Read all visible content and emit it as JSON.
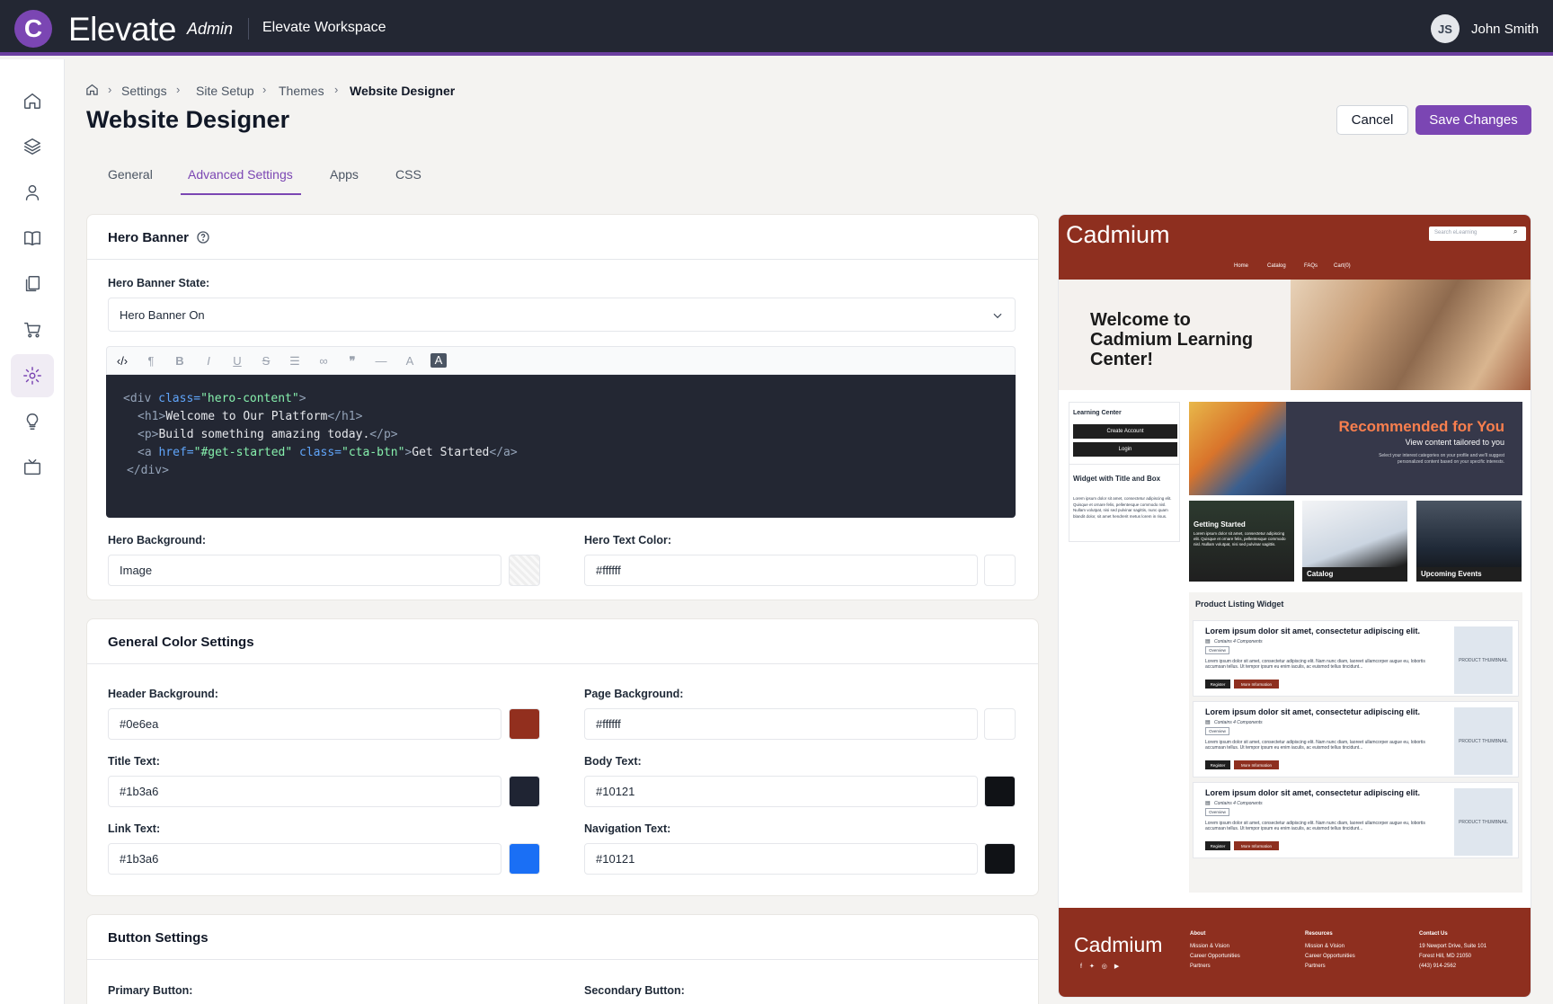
{
  "topbar": {
    "logo_letter": "C",
    "brand": "Elevate",
    "brand_sub": "Admin",
    "workspace": "Elevate Workspace",
    "user_initials": "JS",
    "user_name": "John Smith"
  },
  "breadcrumb": {
    "items": [
      "Settings",
      "Site Setup",
      "Themes"
    ],
    "current": "Website Designer"
  },
  "page": {
    "title": "Website Designer",
    "cancel": "Cancel",
    "save": "Save Changes"
  },
  "tabs": [
    "General",
    "Advanced Settings",
    "Apps",
    "CSS"
  ],
  "hero": {
    "title": "Hero Banner",
    "state_label": "Hero Banner State:",
    "state_value": "Hero Banner On",
    "code": {
      "l1a": "<div ",
      "l1b": "class=",
      "l1c": "\"hero-content\"",
      "l1d": ">",
      "l2a": "<h1>",
      "l2b": "Welcome to Our Platform",
      "l2c": "</h1>",
      "l3a": "<p>",
      "l3b": "Build something amazing today.",
      "l3c": "</p>",
      "l4a": "<a ",
      "l4b": "href=",
      "l4c": "\"#get-started\"",
      "l4d": " class=",
      "l4e": "\"cta-btn\"",
      "l4f": ">",
      "l4g": "Get Started",
      "l4h": "</a>",
      "l5": "</div>"
    },
    "bg_label": "Hero Background:",
    "bg_value": "Image",
    "text_color_label": "Hero Text Color:",
    "text_color_value": "#ffffff"
  },
  "colors": {
    "title": "General Color Settings",
    "header_bg_label": "Header Background:",
    "header_bg_value": "#0e6ea",
    "page_bg_label": "Page Background:",
    "page_bg_value": "#ffffff",
    "title_text_label": "Title Text:",
    "title_text_value": "#1b3a6",
    "body_text_label": "Body Text:",
    "body_text_value": "#10121",
    "link_text_label": "Link Text:",
    "link_text_value": "#1b3a6",
    "nav_text_label": "Navigation Text:",
    "nav_text_value": "#10121",
    "swatches": {
      "header": "#922f1e",
      "page": "#ffffff",
      "title": "#1f2433",
      "body": "#101216",
      "link": "#1a6ff5",
      "nav": "#101216"
    }
  },
  "buttons": {
    "title": "Button Settings",
    "primary_label": "Primary Button:",
    "secondary_label": "Secondary Button:"
  },
  "preview": {
    "brand": "Cadmium",
    "search_placeholder": "Search eLearning",
    "nav": [
      "Home",
      "Catalog",
      "FAQs",
      "Cart(0)"
    ],
    "hero_heading": "Welcome to Cadmium Learning Center!",
    "side_title": "Learning Center",
    "create_account": "Create Account",
    "login": "Login",
    "widget_title": "Widget with Title and Box",
    "widget_text": "Lorem ipsum dolor sit amet, consectetur adipiscing elit. Quisque et ornare felis, pellentesque commodo nisl. Nullam volutpat, nisi sed pulvinar sagittis, nunc quam blandit dolor, sit amet hendrerit metus lorem in risus.",
    "rec_title": "Recommended for You",
    "rec_sub": "View content tailored to you",
    "rec_text": "Select your interest categories on your profile and we'll suggest personalized content based on your specific interests.",
    "tile_getting_started": "Getting Started",
    "tile_gs_text": "Lorem ipsum dolor sit amet, consectetur adipiscing elit. Quisque et ornare felis, pellentesque commodo nisl. Nullam volutpat, nisi sed pulvinar sagittis.",
    "tile_catalog": "Catalog",
    "tile_events": "Upcoming Events",
    "product_widget": "Product Listing Widget",
    "product_title": "Lorem ipsum dolor sit amet, consectetur adipiscing elit.",
    "product_components": "Contains 4 Components",
    "product_overview": "Overview",
    "product_text": "Lorem ipsum dolor sit amet, consectetur adipiscing elit. Nam nunc diam, laoreet ullamcorper augue eu, lobortis accumsan tellus. Ut tempor ipsum eu enim iaculis, ac euismod tellus tincidunt...",
    "product_register": "Register",
    "product_more": "More Information",
    "product_thumb": "PRODUCT THUMBNAIL",
    "footer": {
      "brand": "Cadmium",
      "about": "About",
      "resources": "Resources",
      "contact": "Contact Us",
      "link1": "Mission & Vision",
      "link2": "Career Opportunities",
      "link3": "Partners",
      "addr1": "19 Newport Drive, Suite 101",
      "addr2": "Forest Hill, MD 21050",
      "phone": "(443) 914-2562"
    }
  }
}
